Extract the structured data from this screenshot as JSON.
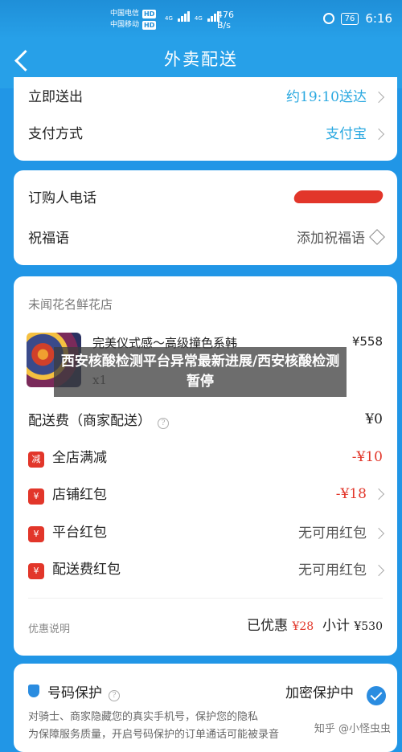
{
  "status": {
    "carrier1": "中国电信",
    "carrier2": "中国移动",
    "hd": "HD",
    "net1": "4G",
    "net2": "4G",
    "speed_value": "476",
    "speed_unit": "B/s",
    "battery": "76",
    "time": "6:16"
  },
  "header": {
    "title": "外卖配送"
  },
  "delivery": {
    "now_label": "立即送出",
    "now_value": "约19:10送达",
    "pay_label": "支付方式",
    "pay_value": "支付宝"
  },
  "contact": {
    "phone_label": "订购人电话",
    "blessing_label": "祝福语",
    "blessing_value": "添加祝福语"
  },
  "order": {
    "shop": "未闻花名鲜花店",
    "product_name": "完美仪式感～高级撞色系韩",
    "product_qty": "x1",
    "product_price": "¥558",
    "delivery_fee_label": "配送费（商家配送）",
    "delivery_fee_value": "¥0",
    "discounts": [
      {
        "badge": "减",
        "label": "全店满减",
        "value": "-¥10"
      },
      {
        "badge": "¥",
        "label": "店铺红包",
        "value": "-¥18"
      },
      {
        "badge": "¥",
        "label": "平台红包",
        "value": "无可用红包"
      },
      {
        "badge": "¥",
        "label": "配送费红包",
        "value": "无可用红包"
      }
    ],
    "discount_note": "优惠说明",
    "saved_label": "已优惠",
    "saved_value": "¥28",
    "subtotal_label": "小计",
    "subtotal_value": "¥530"
  },
  "privacy": {
    "title": "号码保护",
    "status": "加密保护中",
    "note": "对骑士、商家隐藏您的真实手机号，保护您的隐私\n为保障服务质量，开启号码保护的订单通话可能被录音"
  },
  "overlay": {
    "headline": "西安核酸检测平台异常最新进展/西安核酸检测暂停"
  },
  "watermark": "知乎 @小怪虫虫"
}
